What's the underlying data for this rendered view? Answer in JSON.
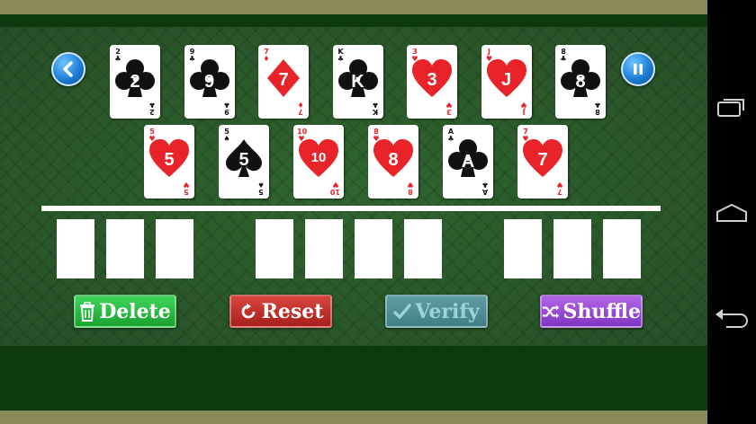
{
  "top_row": [
    {
      "rank": "2",
      "suit": "clubs",
      "color": "black"
    },
    {
      "rank": "9",
      "suit": "clubs",
      "color": "black"
    },
    {
      "rank": "7",
      "suit": "diamonds",
      "color": "red"
    },
    {
      "rank": "K",
      "suit": "clubs",
      "color": "black"
    },
    {
      "rank": "3",
      "suit": "hearts",
      "color": "red"
    },
    {
      "rank": "J",
      "suit": "hearts",
      "color": "red"
    },
    {
      "rank": "8",
      "suit": "clubs",
      "color": "black"
    }
  ],
  "second_row": [
    {
      "rank": "5",
      "suit": "hearts",
      "color": "red"
    },
    {
      "rank": "5",
      "suit": "spades",
      "color": "black"
    },
    {
      "rank": "10",
      "suit": "hearts",
      "color": "red"
    },
    {
      "rank": "8",
      "suit": "hearts",
      "color": "red"
    },
    {
      "rank": "A",
      "suit": "clubs",
      "color": "black"
    },
    {
      "rank": "7",
      "suit": "hearts",
      "color": "red"
    }
  ],
  "buttons": {
    "delete": "Delete",
    "reset": "Reset",
    "verify": "Verify",
    "shuffle": "Shuffle"
  },
  "icons": {
    "back": "chevron-left-icon",
    "pause": "pause-icon"
  },
  "colors": {
    "felt": "#2a5b2a",
    "red_suit": "#e8242a",
    "black_suit": "#111111",
    "delete": "#1aa230",
    "reset": "#a91f1c",
    "verify": "#3f7f85",
    "shuffle": "#8034c2"
  }
}
